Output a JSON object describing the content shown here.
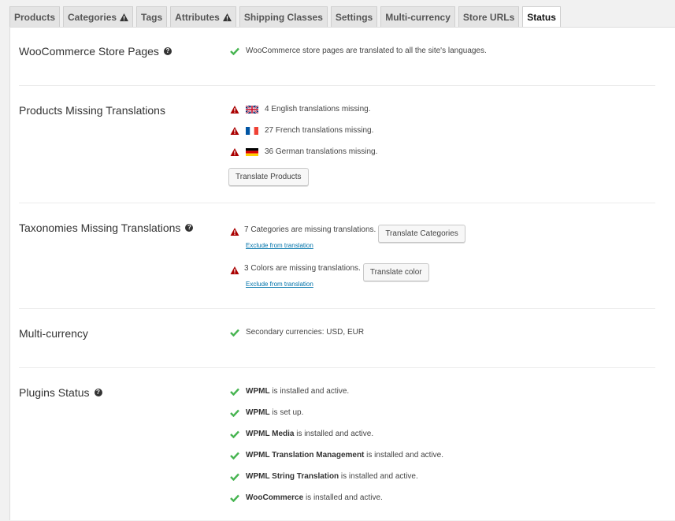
{
  "tabs": [
    {
      "label": "Products"
    },
    {
      "label": "Categories"
    },
    {
      "label": "Tags"
    },
    {
      "label": "Attributes"
    },
    {
      "label": "Shipping Classes"
    },
    {
      "label": "Settings"
    },
    {
      "label": "Multi-currency"
    },
    {
      "label": "Store URLs"
    },
    {
      "label": "Status"
    }
  ],
  "store_pages": {
    "title": "WooCommerce Store Pages",
    "message": "WooCommerce store pages are translated to all the site's languages."
  },
  "products_missing": {
    "title": "Products Missing Translations",
    "items": [
      {
        "text": "4 English translations missing.",
        "flag": "uk-flag-icon"
      },
      {
        "text": "27 French translations missing.",
        "flag": "france-flag-icon"
      },
      {
        "text": "36 German translations missing.",
        "flag": "germany-flag-icon"
      }
    ],
    "button": "Translate Products"
  },
  "taxonomies_missing": {
    "title": "Taxonomies Missing Translations",
    "items": [
      {
        "text": "7 Categories are missing translations.",
        "button": "Translate Categories",
        "link": "Exclude from translation"
      },
      {
        "text": "3 Colors are missing translations.",
        "button": "Translate color",
        "link": "Exclude from translation"
      }
    ]
  },
  "multi_currency": {
    "title": "Multi-currency",
    "message": "Secondary currencies: USD, EUR"
  },
  "plugins": {
    "title": "Plugins Status",
    "items": [
      {
        "name": "WPML",
        "rest": " is installed and active."
      },
      {
        "name": "WPML",
        "rest": " is set up."
      },
      {
        "name": "WPML Media",
        "rest": " is installed and active."
      },
      {
        "name": "WPML Translation Management",
        "rest": " is installed and active."
      },
      {
        "name": "WPML String Translation",
        "rest": " is installed and active."
      },
      {
        "name": "WooCommerce",
        "rest": " is installed and active."
      }
    ]
  },
  "colors": {
    "check": "#46b450",
    "warning": "#a00",
    "link": "#0073aa"
  }
}
